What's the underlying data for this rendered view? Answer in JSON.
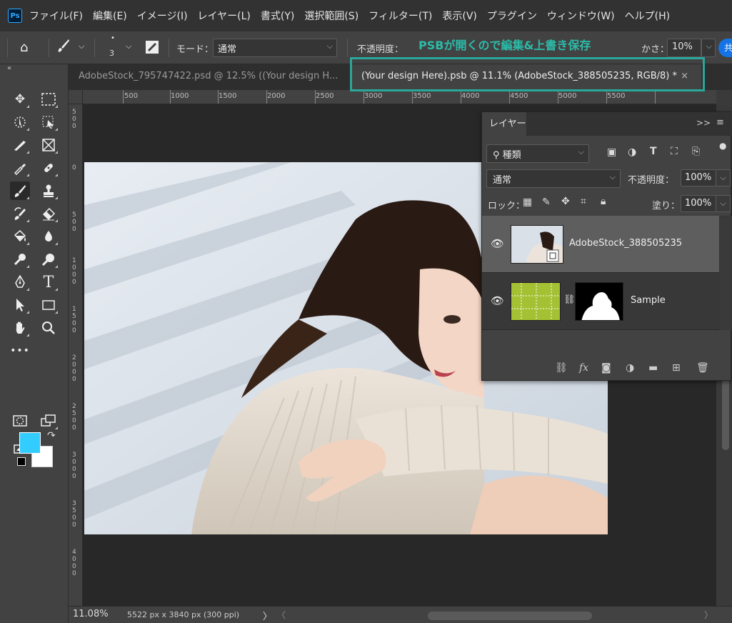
{
  "app": {
    "logo": "Ps",
    "menu": [
      "ファイル(F)",
      "編集(E)",
      "イメージ(I)",
      "レイヤー(L)",
      "書式(Y)",
      "選択範囲(S)",
      "フィルター(T)",
      "表示(V)",
      "プラグイン",
      "ウィンドウ(W)",
      "ヘルプ(H)"
    ]
  },
  "options": {
    "brush_size": "3",
    "mode_label": "モード：",
    "mode_value": "通常",
    "opacity_label": "不透明度：",
    "smoothing_label_tail": "かさ：",
    "smoothing_value": "10%",
    "blue_button": "共"
  },
  "tabs": {
    "tab1": "AdobeStock_795747422.psd @ 12.5% ((Your design H...",
    "tab2": "(Your design Here).psb @ 11.1% (AdobeStock_388505235, RGB/8) *",
    "close": "×",
    "collapse": "«"
  },
  "callout": {
    "label": "PSBが開くので編集&上書き保存",
    "color": "#2aa79b"
  },
  "ruler": {
    "top_labels": [
      "500",
      "1000",
      "1500",
      "2000",
      "2500",
      "3000",
      "3500",
      "4000",
      "4500",
      "5000",
      "5500"
    ],
    "left_labels": [
      "5 0 0",
      "0",
      "5 0 0",
      "1 0 0 0",
      "1 5 0 0",
      "2 0 0 0",
      "2 5 0 0",
      "3 0 0 0",
      "3 5 0 0",
      "4 0 0 0"
    ]
  },
  "colors": {
    "foreground": "#33ccff",
    "background": "#ffffff"
  },
  "layers_panel": {
    "tab": "レイヤー",
    "expand": ">>",
    "menu": "≡",
    "filter_value": "種類",
    "blend_mode": "通常",
    "opacity_label": "不透明度：",
    "opacity_value": "100%",
    "lock_label": "ロック：",
    "fill_label": "塗り：",
    "fill_value": "100%",
    "layers": [
      {
        "name": "AdobeStock_388505235",
        "selected": true
      },
      {
        "name": "Sample",
        "selected": false
      }
    ]
  },
  "status": {
    "zoom": "11.08%",
    "doc_size": "5522 px x 3840 px (300 ppi)",
    "arrow": "〉",
    "scroll_left": "〈",
    "scroll_right": "〉"
  }
}
